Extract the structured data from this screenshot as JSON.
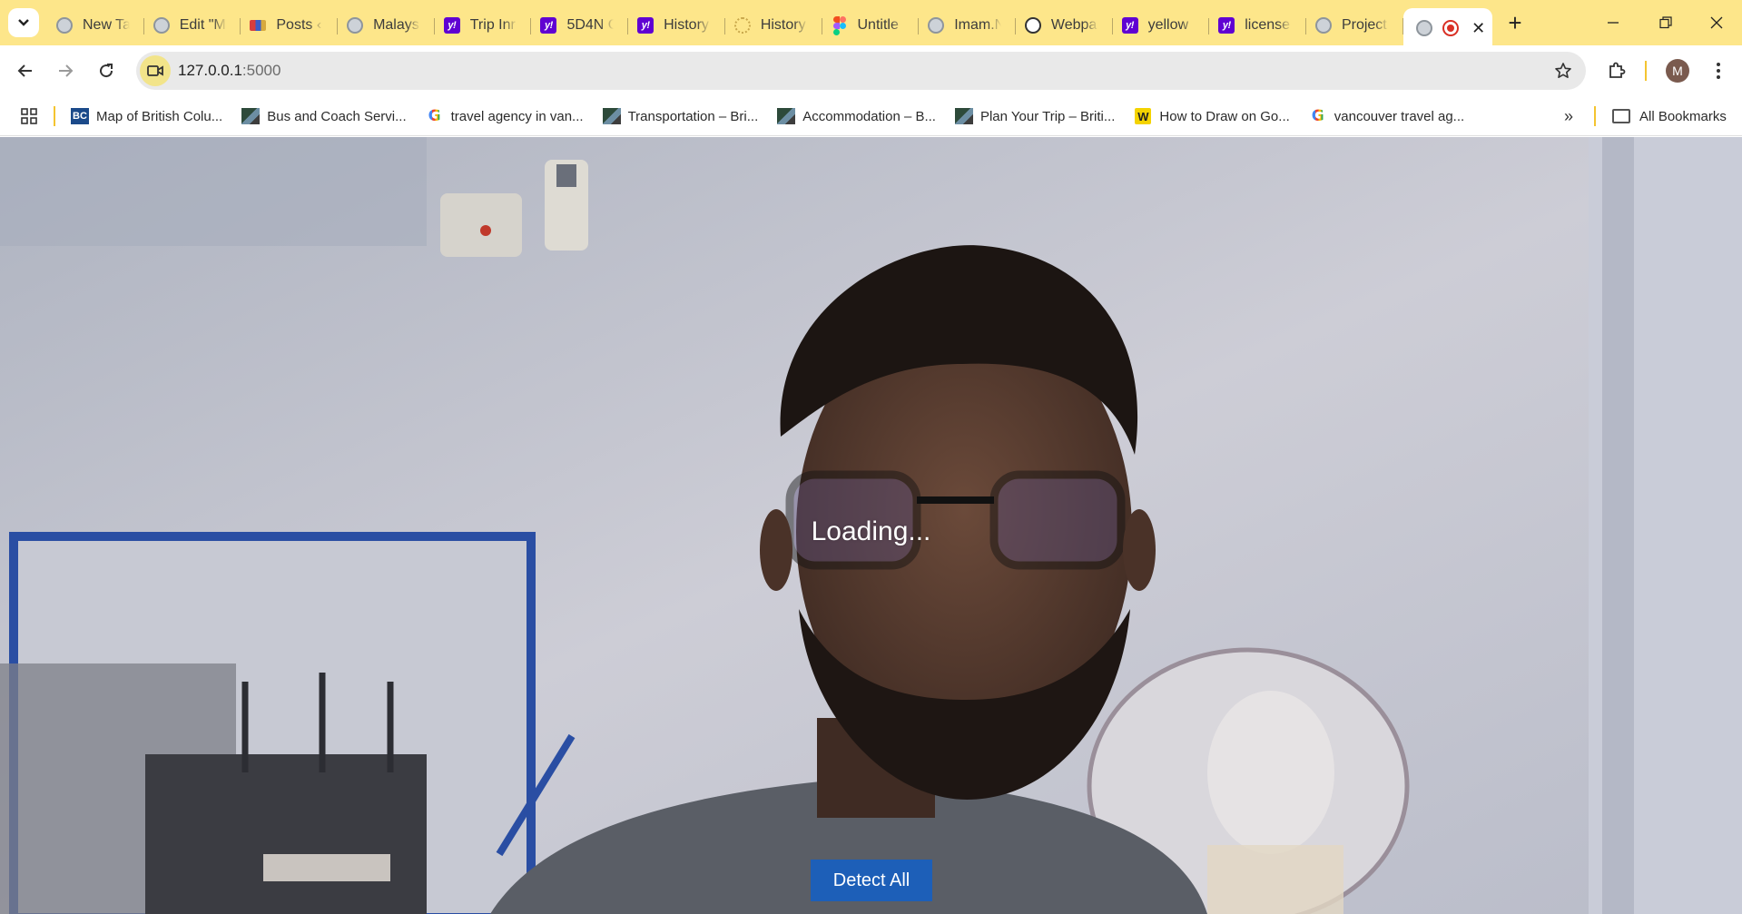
{
  "browser": {
    "tabs": [
      {
        "title": "New Ta",
        "icon": "globe-icon"
      },
      {
        "title": "Edit \"M",
        "icon": "globe-icon"
      },
      {
        "title": "Posts ‹",
        "icon": "posts-icon"
      },
      {
        "title": "Malays",
        "icon": "globe-icon"
      },
      {
        "title": "Trip Inr",
        "icon": "yahoo-icon"
      },
      {
        "title": "5D4N C",
        "icon": "yahoo-icon"
      },
      {
        "title": "History",
        "icon": "yahoo-icon"
      },
      {
        "title": "History",
        "icon": "history-icon"
      },
      {
        "title": "Untitle",
        "icon": "figma-icon"
      },
      {
        "title": "Imam.N",
        "icon": "globe-icon"
      },
      {
        "title": "Webpa",
        "icon": "chatgpt-icon"
      },
      {
        "title": "yellow",
        "icon": "yahoo-icon"
      },
      {
        "title": "license",
        "icon": "yahoo-icon"
      },
      {
        "title": "Project",
        "icon": "globe-icon"
      }
    ],
    "active_tab": {
      "title": "",
      "icon": "recording-icon"
    },
    "address": {
      "host": "127.0.0.1",
      "port": ":5000"
    },
    "profile_initial": "M",
    "bookmarks": [
      {
        "label": "Map of British Colu...",
        "icon": "bc-icon"
      },
      {
        "label": "Bus and Coach Servi...",
        "icon": "site-icon"
      },
      {
        "label": "travel agency in van...",
        "icon": "google-icon"
      },
      {
        "label": "Transportation – Bri...",
        "icon": "site-icon"
      },
      {
        "label": "Accommodation – B...",
        "icon": "site-icon"
      },
      {
        "label": "Plan Your Trip – Briti...",
        "icon": "site-icon"
      },
      {
        "label": "How to Draw on Go...",
        "icon": "w-icon"
      },
      {
        "label": "vancouver travel ag...",
        "icon": "google-icon"
      }
    ],
    "all_bookmarks_label": "All Bookmarks",
    "colors": {
      "tabstrip": "#fde68a",
      "accent": "#f4c430"
    }
  },
  "page": {
    "loading_text": "Loading...",
    "detect_button_label": "Detect All",
    "detect_button_color": "#1d5fb8"
  }
}
